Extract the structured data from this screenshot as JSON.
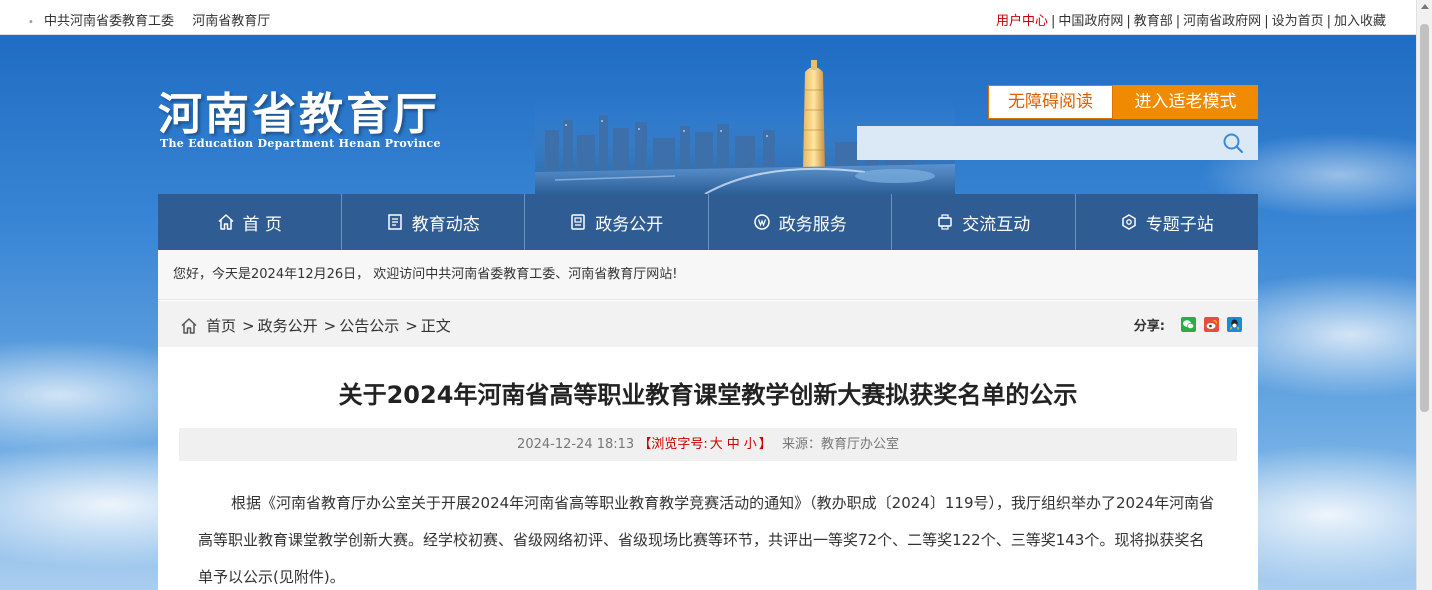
{
  "topbar": {
    "left_items": [
      "中共河南省委教育工委",
      "河南省教育厅"
    ],
    "right_links": [
      {
        "label": "用户中心",
        "highlight": true
      },
      {
        "label": "中国政府网",
        "highlight": false
      },
      {
        "label": "教育部",
        "highlight": false
      },
      {
        "label": "河南省政府网",
        "highlight": false
      },
      {
        "label": "设为首页",
        "highlight": false
      },
      {
        "label": "加入收藏",
        "highlight": false
      }
    ],
    "separator": "|"
  },
  "header": {
    "logo_cn": "河南省教育厅",
    "logo_en": "The Education Department Henan Province",
    "accessibility_button": "无障碍阅读",
    "elder_mode_button": "进入适老模式",
    "search_placeholder": ""
  },
  "nav": {
    "items": [
      {
        "label": "首 页",
        "icon": "home-icon"
      },
      {
        "label": "教育动态",
        "icon": "news-icon"
      },
      {
        "label": "政务公开",
        "icon": "document-icon"
      },
      {
        "label": "政务服务",
        "icon": "service-icon"
      },
      {
        "label": "交流互动",
        "icon": "interaction-icon"
      },
      {
        "label": "专题子站",
        "icon": "topics-icon"
      }
    ]
  },
  "welcome": "您好，今天是2024年12月26日， 欢迎访问中共河南省委教育工委、河南省教育厅网站!",
  "breadcrumb": {
    "items": [
      "首页",
      "政务公开",
      "公告公示"
    ],
    "current": "正文",
    "separator": ">"
  },
  "share": {
    "label": "分享:",
    "targets": [
      "wechat-icon",
      "weibo-icon",
      "qq-icon"
    ]
  },
  "article": {
    "title": "关于2024年河南省高等职业教育课堂教学创新大赛拟获奖名单的公示",
    "date": "2024-12-24 18:13",
    "font_size_prefix": "【浏览字号:",
    "font_size_large": "大",
    "font_size_medium": "中",
    "font_size_small": "小",
    "font_size_suffix": "】",
    "source": "来源：教育厅办公室",
    "paragraph": "根据《河南省教育厅办公室关于开展2024年河南省高等职业教育教学竞赛活动的通知》（教办职成〔2024〕119号），我厅组织举办了2024年河南省高等职业教育课堂教学创新大赛。经学校初赛、省级网络初评、省级现场比赛等环节，共评出一等奖72个、二等奖122个、三等奖143个。现将拟获奖名单予以公示(见附件)。"
  },
  "colors": {
    "nav_bg": "#2f5d93",
    "accent_orange": "#f08a00",
    "link_red": "#cc0000"
  }
}
